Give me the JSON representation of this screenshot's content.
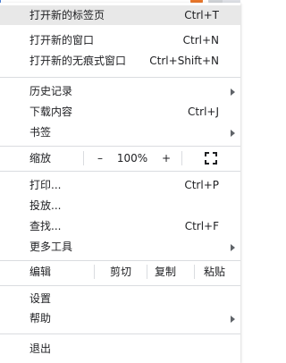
{
  "menu": {
    "new_tab": {
      "label": "打开新的标签页",
      "shortcut": "Ctrl+T"
    },
    "new_window": {
      "label": "打开新的窗口",
      "shortcut": "Ctrl+N"
    },
    "new_incognito": {
      "label": "打开新的无痕式窗口",
      "shortcut": "Ctrl+Shift+N"
    },
    "history": {
      "label": "历史记录"
    },
    "downloads": {
      "label": "下载内容",
      "shortcut": "Ctrl+J"
    },
    "bookmarks": {
      "label": "书签"
    },
    "zoom": {
      "label": "缩放",
      "minus": "–",
      "value": "100%",
      "plus": "+"
    },
    "print": {
      "label": "打印...",
      "shortcut": "Ctrl+P"
    },
    "cast": {
      "label": "投放..."
    },
    "find": {
      "label": "查找...",
      "shortcut": "Ctrl+F"
    },
    "more_tools": {
      "label": "更多工具"
    },
    "edit": {
      "label": "编辑",
      "cut": "剪切",
      "copy": "复制",
      "paste": "粘贴"
    },
    "settings": {
      "label": "设置"
    },
    "help": {
      "label": "帮助"
    },
    "exit": {
      "label": "退出"
    }
  },
  "colors": {
    "highlight": "#e8e8e8",
    "separator": "#dadce0",
    "text": "#202124"
  }
}
